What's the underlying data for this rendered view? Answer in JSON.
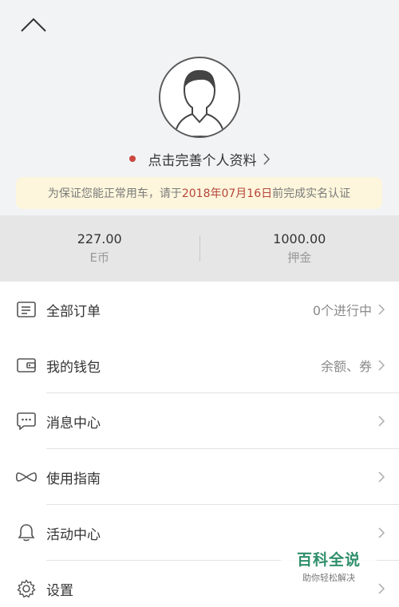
{
  "profile": {
    "complete_prompt": "点击完善个人资料"
  },
  "notice": {
    "prefix": "为保证您能正常用车，请于",
    "date": "2018年07月16日",
    "suffix": "前完成实名认证"
  },
  "stats": [
    {
      "value": "227.00",
      "label": "E币"
    },
    {
      "value": "1000.00",
      "label": "押金"
    }
  ],
  "menu": {
    "items": [
      {
        "label": "全部订单",
        "value": "0个进行中",
        "icon": "order-list-icon"
      },
      {
        "label": "我的钱包",
        "value": "余额、券",
        "icon": "wallet-icon"
      },
      {
        "label": "消息中心",
        "value": "",
        "icon": "message-icon"
      },
      {
        "label": "使用指南",
        "value": "",
        "icon": "guide-icon"
      },
      {
        "label": "活动中心",
        "value": "",
        "icon": "bell-icon"
      },
      {
        "label": "设置",
        "value": "",
        "icon": "gear-icon"
      }
    ]
  },
  "watermark": {
    "title": "百科全说",
    "subtitle": "助你轻松解决"
  },
  "colors": {
    "accent_red": "#c9483f",
    "notice_bg": "#fdf6dc",
    "stats_bg": "#e6e6e6",
    "header_bg": "#f1f3f5"
  }
}
